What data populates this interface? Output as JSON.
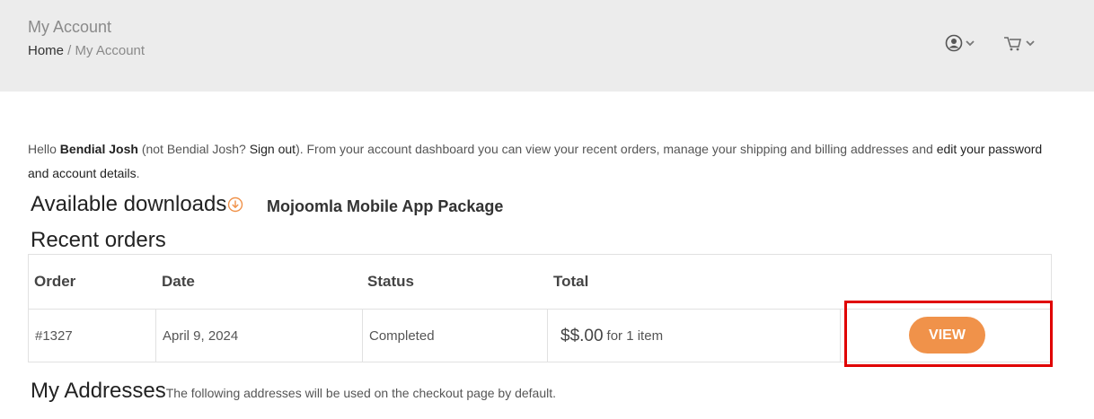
{
  "header": {
    "title": "My Account",
    "breadcrumb": {
      "home": "Home",
      "separator": " / ",
      "current": "My Account"
    },
    "icons": {
      "user": "user-icon",
      "cart": "cart-icon",
      "chevron": "chevron-down-icon"
    }
  },
  "intro": {
    "hello": "Hello ",
    "user_name": "Bendial Josh",
    "not_prefix": " (not Bendial Josh? ",
    "sign_out": "Sign out",
    "mid": "). From your account dashboard you can view your recent orders, manage your shipping and billing addresses and ",
    "edit_link": "edit your password and account details",
    "end": "."
  },
  "downloads": {
    "heading": "Available downloads",
    "icon": "download-circle-icon",
    "package": "Mojoomla Mobile App Package"
  },
  "orders": {
    "heading": "Recent orders",
    "columns": [
      "Order",
      "Date",
      "Status",
      "Total"
    ],
    "rows": [
      {
        "order": "#1327",
        "date": "April 9, 2024",
        "status": "Completed",
        "amount": "$$.00",
        "items": "for 1 item",
        "action": "VIEW"
      }
    ]
  },
  "addresses": {
    "heading": "My Addresses",
    "subtitle": "The following addresses will be used on the checkout page by default."
  },
  "colors": {
    "accent": "#f0924a",
    "highlight": "#e00000",
    "header_bg": "#ececec"
  }
}
